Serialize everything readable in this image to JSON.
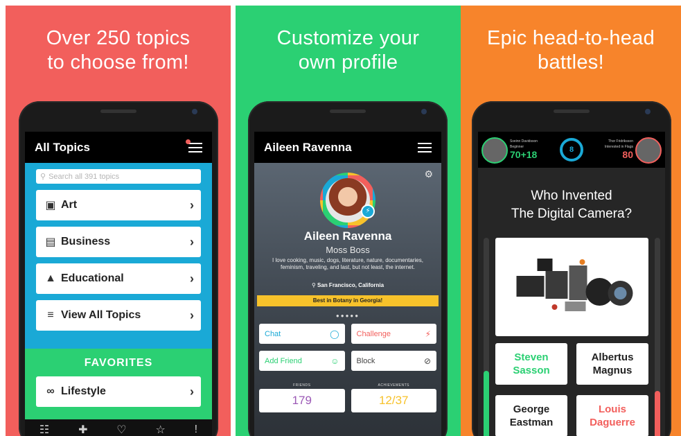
{
  "colors": {
    "red": "#F25F5C",
    "green": "#2BD073",
    "orange": "#F7842B",
    "blue": "#1AA9D6",
    "purple": "#9B59B6",
    "yellow": "#F7C22B"
  },
  "panel1": {
    "headline_line1": "Over 250 topics",
    "headline_line2": "to choose from!",
    "screen_title": "All Topics",
    "search_placeholder": "Search all 391 topics",
    "rows": [
      {
        "icon": "frame-icon",
        "label": "Art"
      },
      {
        "icon": "briefcase-icon",
        "label": "Business"
      },
      {
        "icon": "graduation-cap-icon",
        "label": "Educational"
      },
      {
        "icon": "list-icon",
        "label": "View All Topics"
      }
    ],
    "favorites_heading": "FAVORITES",
    "favorite_row": {
      "icon": "glasses-icon",
      "label": "Lifestyle"
    }
  },
  "panel2": {
    "headline_line1": "Customize your",
    "headline_line2": "own profile",
    "screen_title": "Aileen Ravenna",
    "profile_name": "Aileen Ravenna",
    "profile_subtitle": "Moss Boss",
    "bio": "I love cooking, music, dogs, literature, nature, documentaries, feminism, traveling, and last, but not least, the internet.",
    "location": "San Francisco, California",
    "ribbon": "Best in Botany in Georgia!",
    "buttons": [
      {
        "label": "Chat",
        "color": "#1AA9D6"
      },
      {
        "label": "Challenge",
        "color": "#F25F5C"
      },
      {
        "label": "Add Friend",
        "color": "#2BD073"
      },
      {
        "label": "Block",
        "color": "#444444"
      }
    ],
    "friends_label": "FRIENDS",
    "friends_value": "179",
    "achievements_label": "ACHIEVEMENTS",
    "achievements_value": "12/37"
  },
  "panel3": {
    "headline_line1": "Epic head-to-head",
    "headline_line2": "battles!",
    "player1_name": "Sveinn Davidsson",
    "player1_title": "Beginner",
    "player1_score": "70+18",
    "player2_name": "Thor Fridriksson",
    "player2_title": "Interested in Flags",
    "player2_score": "80",
    "timer": "8",
    "question_line1": "Who Invented",
    "question_line2": "The Digital Camera?",
    "answers": [
      {
        "line1": "Steven",
        "line2": "Sasson",
        "color": "#2BD073"
      },
      {
        "line1": "Albertus",
        "line2": "Magnus",
        "color": "#222222"
      },
      {
        "line1": "George",
        "line2": "Eastman",
        "color": "#222222"
      },
      {
        "line1": "Louis",
        "line2": "Daguerre",
        "color": "#F25F5C"
      }
    ],
    "left_progress": 0.35,
    "right_progress": 0.25
  }
}
